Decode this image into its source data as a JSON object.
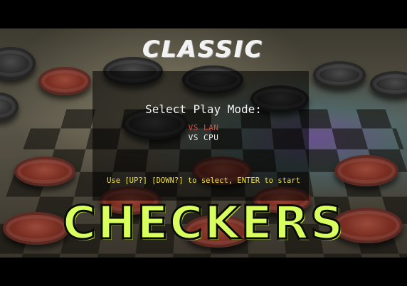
{
  "title_top": "CLASSIC",
  "title_bottom": "CHECKERS",
  "menu": {
    "prompt": "Select Play Mode:",
    "options": [
      {
        "label": "VS LAN",
        "selected": true
      },
      {
        "label": "VS CPU",
        "selected": false
      }
    ]
  },
  "hint": "Use [UP?] [DOWN?] to select, ENTER to start",
  "colors": {
    "selected_option": "#e0483a",
    "unselected_option": "#f0f0f0",
    "hint": "#f2e23a",
    "title_checkers": "#d9ff5e"
  }
}
